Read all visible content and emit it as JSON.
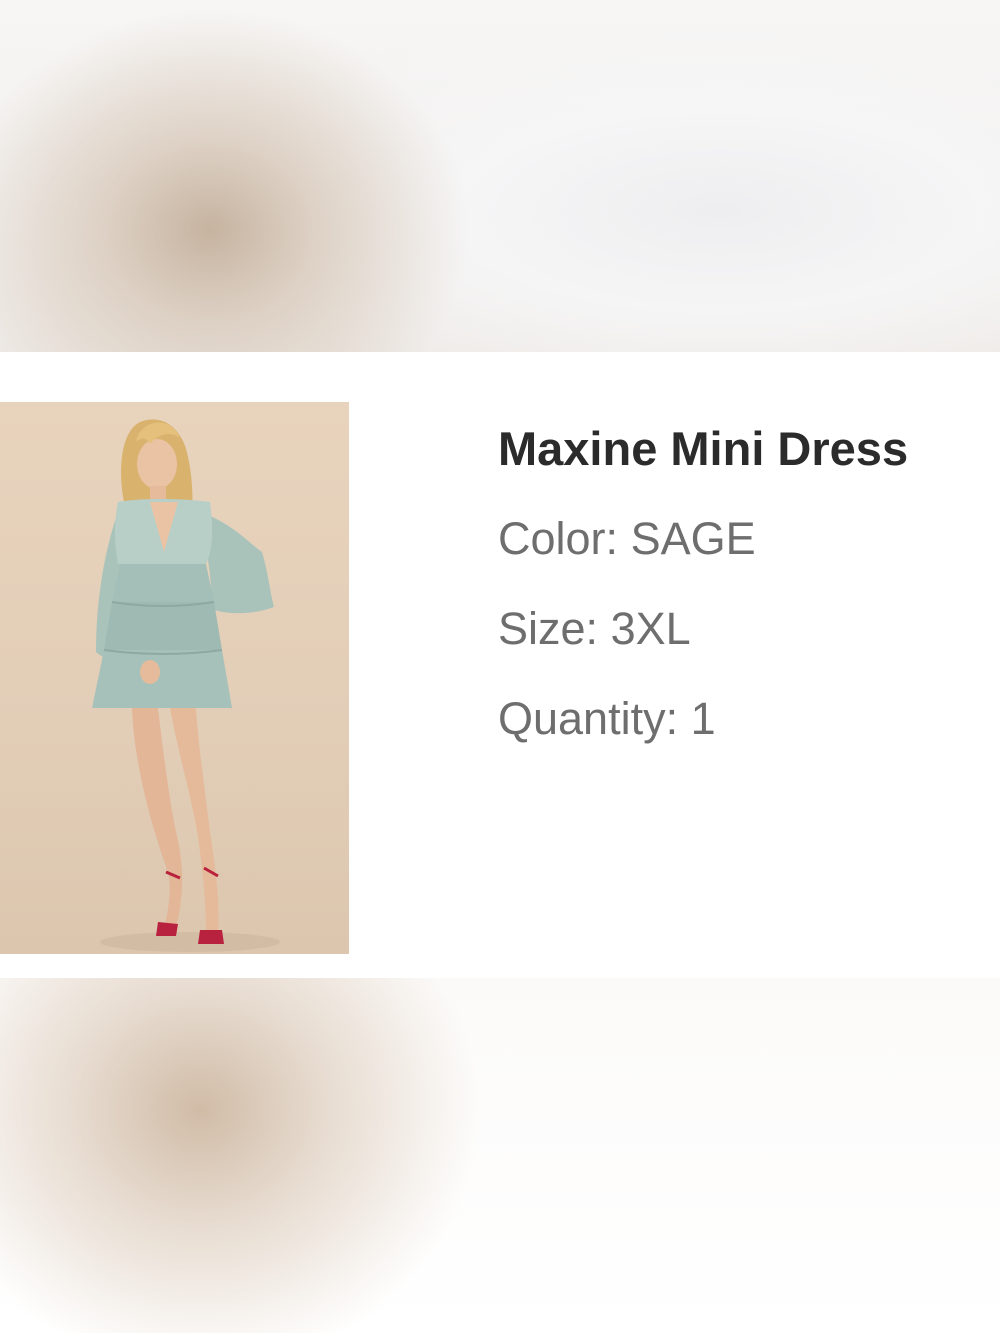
{
  "product": {
    "title": "Maxine Mini Dress",
    "image_alt": "Model wearing sage tiered mini dress with lace bell sleeves and red strappy heels",
    "color_label": "Color:",
    "color_value": "SAGE",
    "size_label": "Size:",
    "size_value": "3XL",
    "quantity_label": "Quantity:",
    "quantity_value": "1"
  },
  "colors": {
    "background": "#ffffff",
    "title_text": "#2b2b2b",
    "detail_text": "#6e6e6e",
    "photo_backdrop": "#e2cdb7",
    "dress": "#a9c3bb",
    "shoes": "#b8223e"
  }
}
